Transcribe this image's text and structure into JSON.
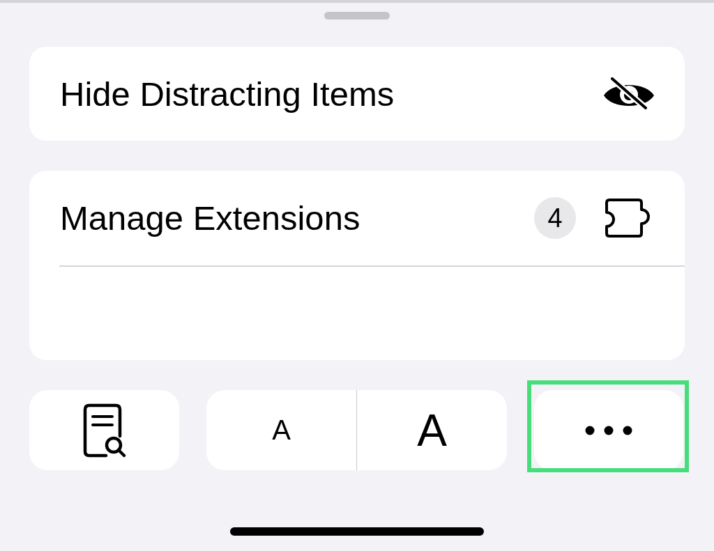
{
  "rows_top": [
    {
      "label": "Hide Distracting Items",
      "kind": "hide"
    }
  ],
  "extensions": {
    "label": "Manage Extensions",
    "count": "4"
  },
  "toolbar": {
    "text_smaller": "A",
    "text_larger": "A",
    "more_highlighted": true
  }
}
